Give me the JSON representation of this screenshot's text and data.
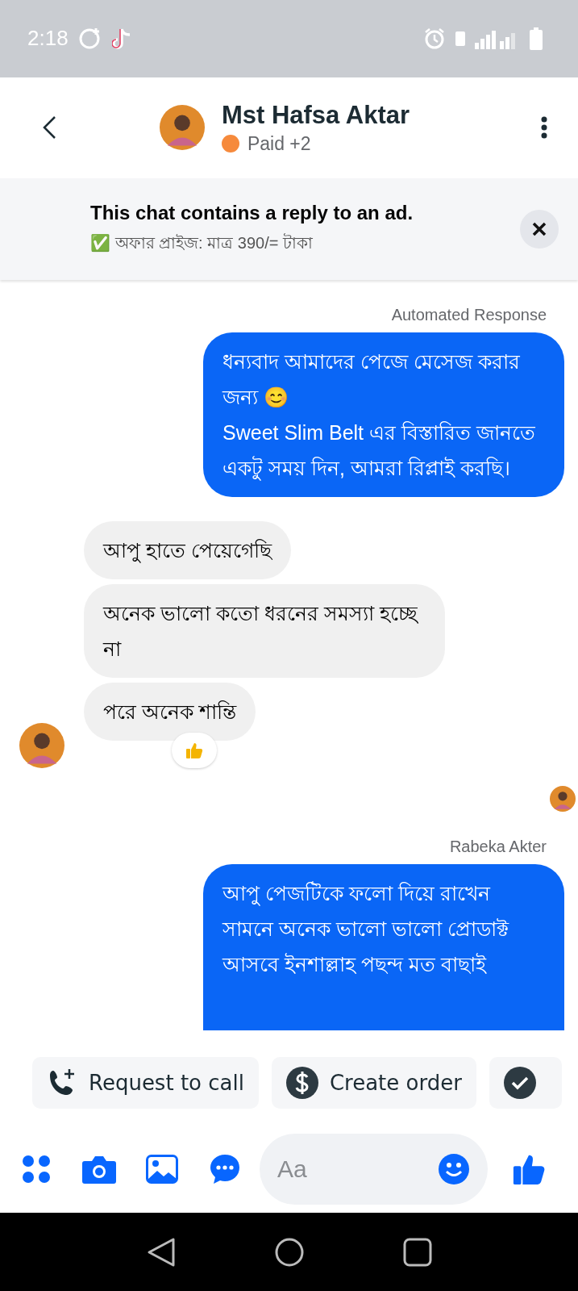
{
  "status_bar": {
    "time": "2:18"
  },
  "header": {
    "name": "Mst Hafsa Aktar",
    "label": {
      "text": "Paid +2",
      "color": "#f68a3c"
    }
  },
  "ad_banner": {
    "title": "This chat contains a reply to an ad.",
    "subtitle": "✅ অফার প্রাইজ: মাত্র 390/= টাকা"
  },
  "messages": [
    {
      "kind": "label",
      "text": "Automated Response"
    },
    {
      "kind": "outgoing",
      "text": "ধন্যবাদ আমাদের পেজে মেসেজ করার জন্য 😊\nSweet Slim Belt এর বিস্তারিত জানতে\nএকটু সময় দিন, আমরা রিপ্লাই করছি।"
    },
    {
      "kind": "incoming",
      "text": "আপু হাতে পেয়েগেছি"
    },
    {
      "kind": "incoming",
      "text": "অনেক ভালো কতো ধরনের সমস্যা হচ্ছে না"
    },
    {
      "kind": "incoming",
      "text": "পরে অনেক শান্তি",
      "avatar": true,
      "reacted": true
    },
    {
      "kind": "seen"
    },
    {
      "kind": "label",
      "text": "Rabeka Akter"
    },
    {
      "kind": "outgoing",
      "text": "আপু পেজটিকে ফলো দিয়ে রাখেন সামনে অনেক ভালো ভালো প্রোডাক্ট আসবে ইনশাল্লাহ পছন্দ মত বাছাই",
      "cut": true
    }
  ],
  "quick_actions": [
    {
      "kind": "call",
      "label": "Request to call"
    },
    {
      "kind": "order",
      "label": "Create order"
    },
    {
      "kind": "done"
    }
  ],
  "composer": {
    "placeholder": "Aa"
  }
}
